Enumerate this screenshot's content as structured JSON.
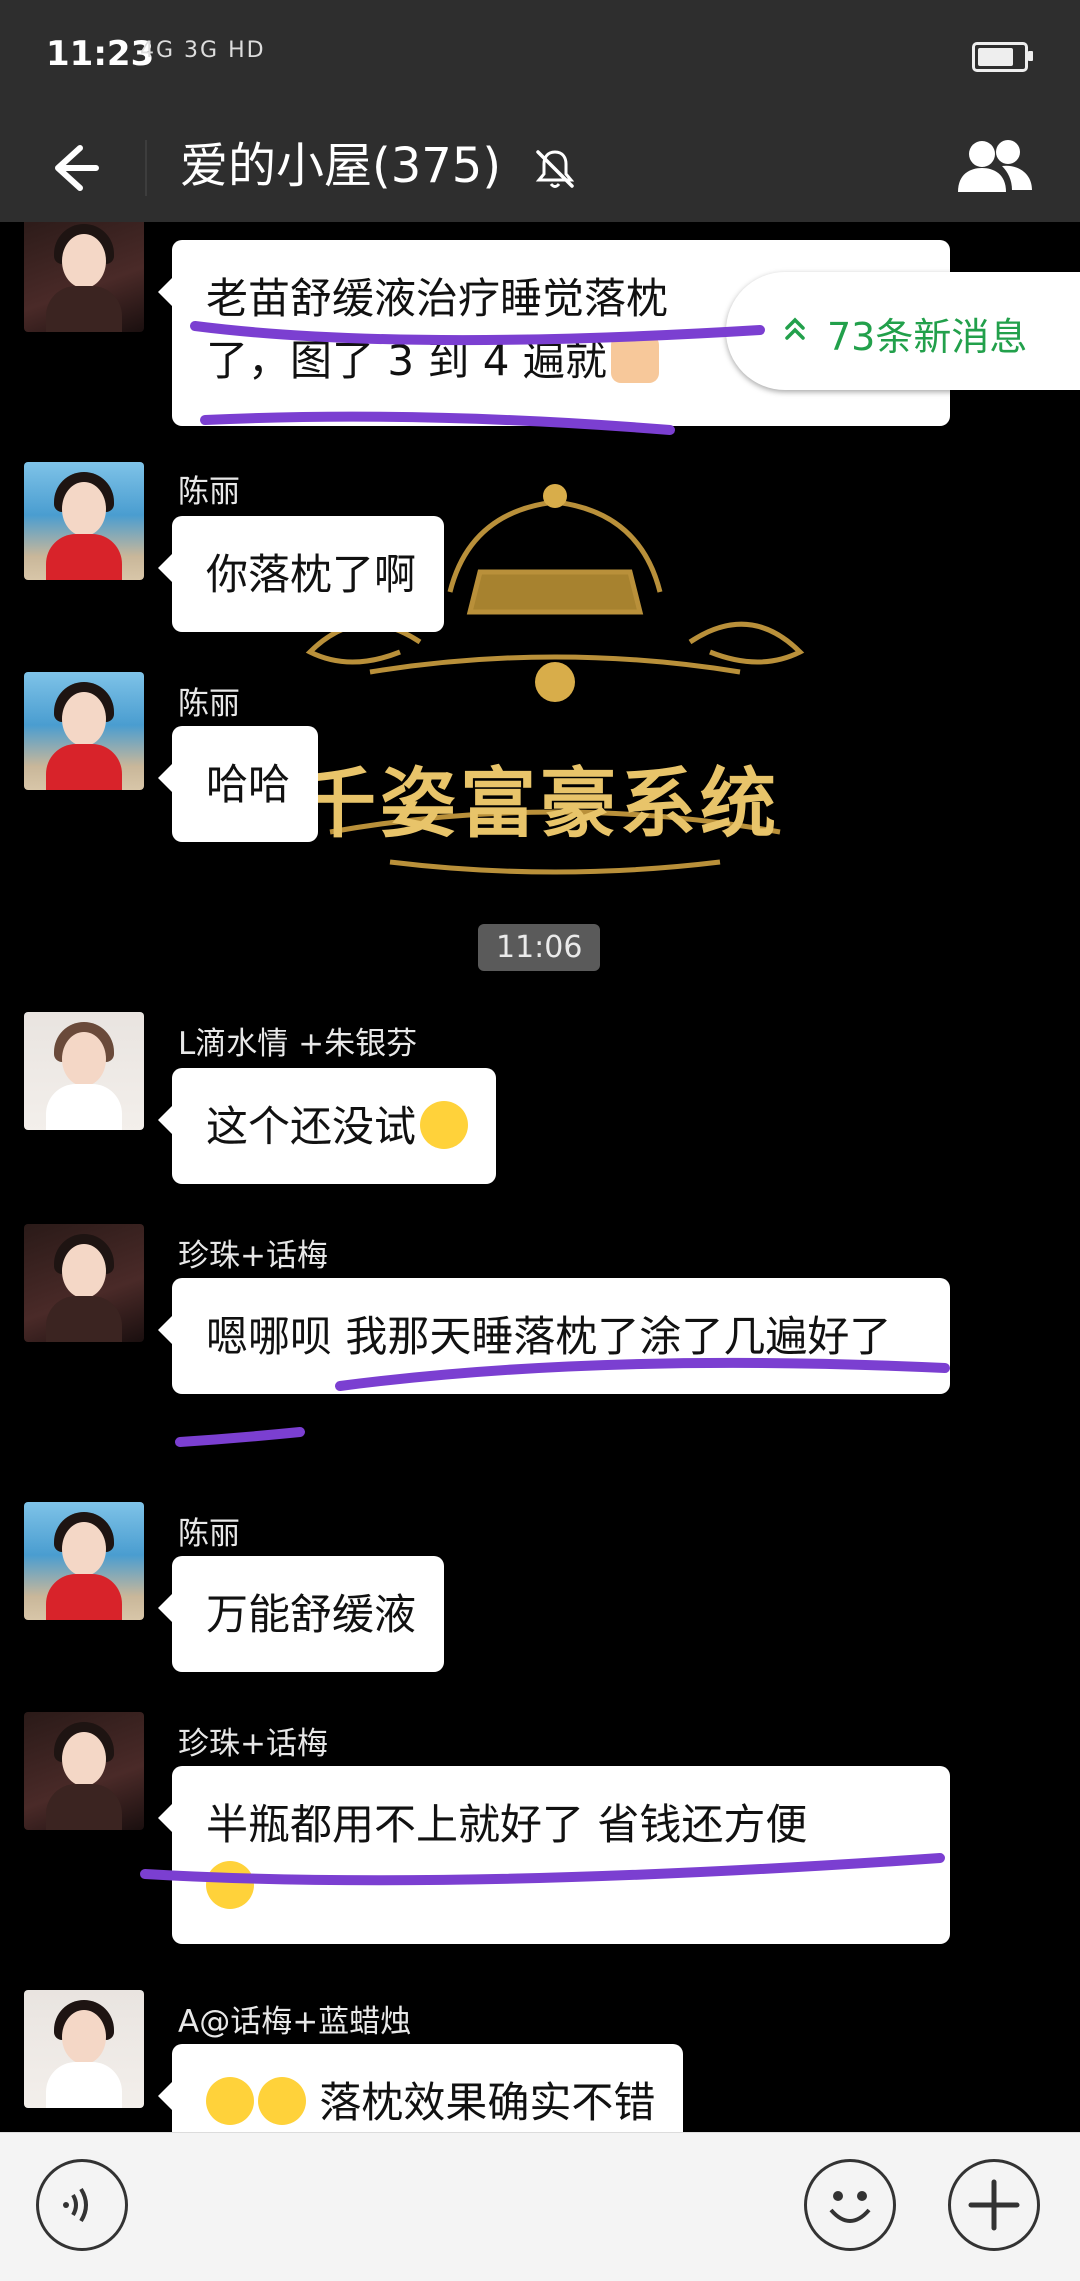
{
  "status_bar": {
    "time": "11:23",
    "network": "4G 3G HD",
    "battery_level": 0.7
  },
  "header": {
    "title": "爱的小屋(375)",
    "muted": true,
    "back_icon": "back-arrow-icon",
    "members_icon": "group-members-icon"
  },
  "new_messages": {
    "label": "73条新消息",
    "icon": "double-chevron-up-icon",
    "color": "#22a04b"
  },
  "timestamp": "11:06",
  "messages": [
    {
      "sender": "",
      "text": "老苗舒缓液治疗睡觉落枕了，图了 3 到 4 遍就",
      "emoji": "ok-hand-icon"
    },
    {
      "sender": "陈丽",
      "text": "你落枕了啊"
    },
    {
      "sender": "陈丽",
      "text": "哈哈"
    },
    {
      "sender": "L滴水情 +朱银芬",
      "text": "这个还没试",
      "emoji": "flushed-face-icon"
    },
    {
      "sender": "珍珠+话梅",
      "text": "嗯哪呗  我那天睡落枕了涂了几遍好了"
    },
    {
      "sender": "陈丽",
      "text": "万能舒缓液"
    },
    {
      "sender": "珍珠+话梅",
      "text": "半瓶都用不上就好了  省钱还方便",
      "emoji": "smiling-face-icon"
    },
    {
      "sender": "A@话梅+蓝蜡烛",
      "text": "落枕效果确实不错",
      "emoji_prefix": "grinning-face-icon"
    }
  ],
  "watermark": {
    "text": "千姿富豪系统",
    "icon": "crown-icon"
  },
  "input_bar": {
    "voice_icon": "voice-input-icon",
    "emoji_icon": "emoji-picker-icon",
    "plus_icon": "plus-icon"
  },
  "accent_colors": {
    "highlight": "#7b3fd1",
    "bar": "#2e2e2e"
  }
}
